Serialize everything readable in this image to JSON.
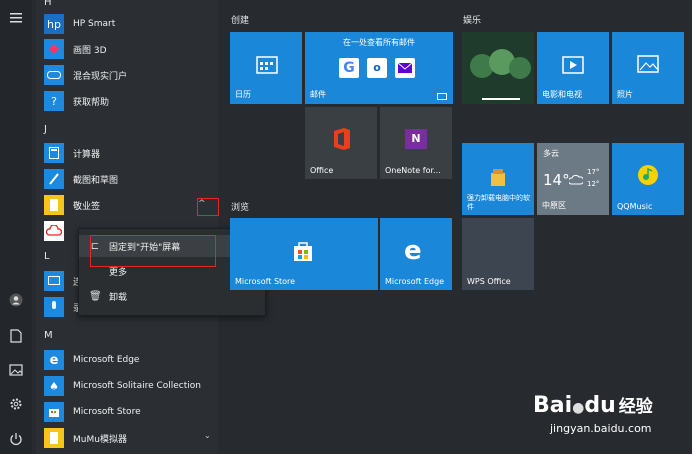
{
  "sidebar": {
    "icons": [
      "menu-icon",
      "user-icon",
      "document-icon",
      "pictures-icon",
      "settings-icon",
      "power-icon"
    ]
  },
  "applist": {
    "letters": {
      "h": "H",
      "j": "J",
      "l": "L",
      "m": "M"
    },
    "apps": [
      {
        "label": "HP Smart",
        "icon": "hp-smart-icon"
      },
      {
        "label": "画图 3D",
        "icon": "paint3d-icon"
      },
      {
        "label": "混合现实门户",
        "icon": "mixed-reality-icon"
      },
      {
        "label": "获取帮助",
        "icon": "help-icon"
      },
      {
        "label": "计算器",
        "icon": "calculator-icon"
      },
      {
        "label": "截图和草图",
        "icon": "snip-sketch-icon"
      },
      {
        "label": "敬业签",
        "icon": "jingyeqian-icon"
      },
      {
        "label": "Microsoft Edge",
        "icon": "edge-icon"
      },
      {
        "label": "Microsoft Solitaire Collection",
        "icon": "solitaire-icon"
      },
      {
        "label": "Microsoft Store",
        "icon": "store-icon"
      },
      {
        "label": "MuMu模拟器",
        "icon": "mumu-icon"
      }
    ],
    "partial_labels": {
      "l1": "连",
      "l2": "录"
    }
  },
  "context_menu": {
    "pin_label": "固定到\"开始\"屏幕",
    "more_label": "更多",
    "uninstall_label": "卸载"
  },
  "groups": {
    "create": "创建",
    "entertainment": "娱乐",
    "browse": "浏览"
  },
  "tiles": {
    "calendar": "日历",
    "mail_header": "在一处查看所有邮件",
    "mail": "邮件",
    "office": "Office",
    "onenote": "OneNote for...",
    "store": "Microsoft Store",
    "edge": "Microsoft Edge",
    "movies": "电影和电视",
    "photos": "照片",
    "uninstall_tool": "强力卸载电脑中的软件",
    "weather_condition": "多云",
    "weather_temp": "14°",
    "weather_hi": "17°",
    "weather_lo": "12°",
    "weather_city": "中原区",
    "qqmusic": "QQMusic",
    "wps": "WPS Office"
  },
  "watermark": {
    "brand": "Bai",
    "brand2": "du",
    "cn": "经验",
    "url": "jingyan.baidu.com"
  },
  "colors": {
    "tile_blue": "#1b87d8",
    "highlight_red": "#e02828"
  }
}
